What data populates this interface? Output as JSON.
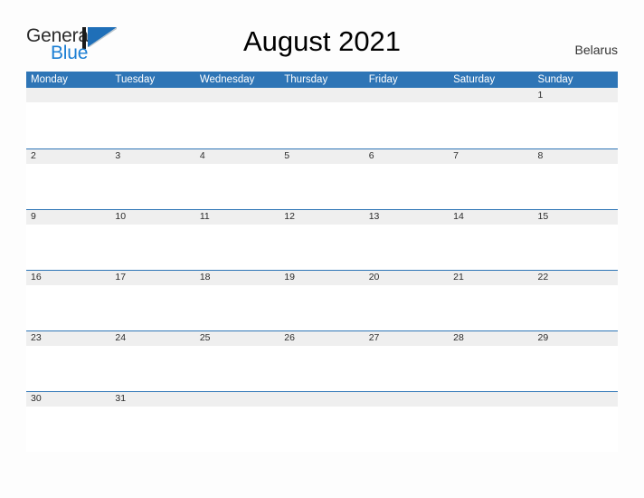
{
  "brand": {
    "name_part1": "General",
    "name_part2": "Blue",
    "flag_icon": "blue-triangle-flag-icon",
    "part1_color": "#2b2b2b",
    "part2_color": "#1c7fd4"
  },
  "header": {
    "title": "August 2021",
    "country": "Belarus"
  },
  "colors": {
    "header_blue": "#2e75b6",
    "row_band_gray": "#efefef",
    "page_background": "#fdfdfd",
    "text_dark": "#2b2b2b"
  },
  "calendar": {
    "month": "August",
    "year": "2021",
    "weekday_headers": [
      "Monday",
      "Tuesday",
      "Wednesday",
      "Thursday",
      "Friday",
      "Saturday",
      "Sunday"
    ],
    "weeks": [
      {
        "days": [
          "",
          "",
          "",
          "",
          "",
          "",
          "1"
        ]
      },
      {
        "days": [
          "2",
          "3",
          "4",
          "5",
          "6",
          "7",
          "8"
        ]
      },
      {
        "days": [
          "9",
          "10",
          "11",
          "12",
          "13",
          "14",
          "15"
        ]
      },
      {
        "days": [
          "16",
          "17",
          "18",
          "19",
          "20",
          "21",
          "22"
        ]
      },
      {
        "days": [
          "23",
          "24",
          "25",
          "26",
          "27",
          "28",
          "29"
        ]
      },
      {
        "days": [
          "30",
          "31",
          "",
          "",
          "",
          "",
          ""
        ]
      }
    ]
  }
}
